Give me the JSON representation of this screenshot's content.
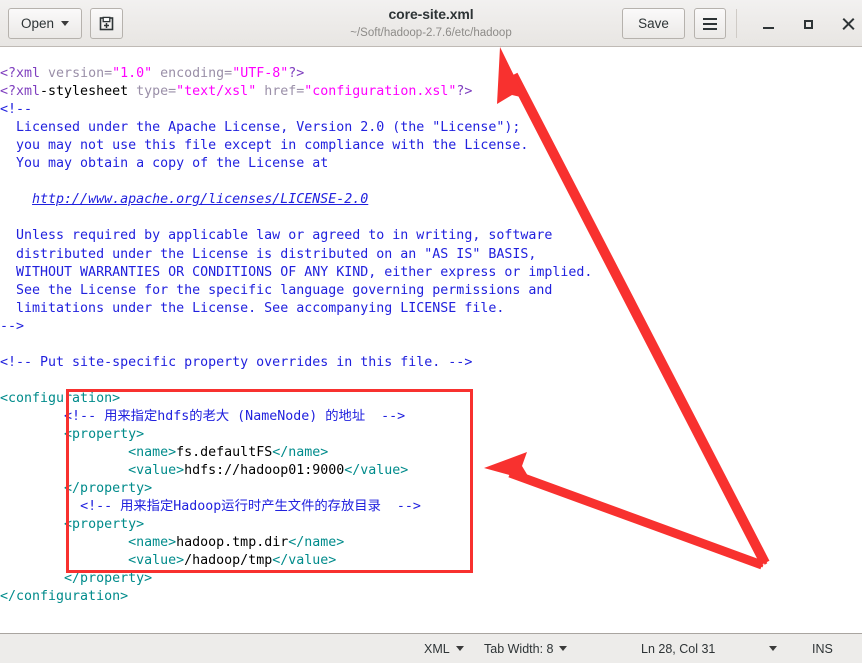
{
  "window": {
    "title": "core-site.xml",
    "subtitle": "~/Soft/hadoop-2.7.6/etc/hadoop"
  },
  "headerbar": {
    "open_label": "Open",
    "open_caret_icon": "chevron-down-icon",
    "new_tab_icon": "new-document-icon",
    "save_label": "Save",
    "menu_icon": "hamburger-menu-icon",
    "minimize_icon": "minimize-icon",
    "maximize_icon": "maximize-icon",
    "close_icon": "close-icon"
  },
  "statusbar": {
    "language": "XML",
    "language_caret_icon": "chevron-down-icon",
    "tab_width": "Tab Width: 8",
    "tab_width_caret_icon": "chevron-down-icon",
    "position": "Ln 28, Col 31",
    "position_caret_icon": "chevron-down-icon",
    "insert_mode": "INS"
  },
  "annotations": {
    "box_color": "#f8312f",
    "arrow_color": "#f8312f",
    "arrow_count": 2,
    "box_label": "highlighted-property-block"
  },
  "colors": {
    "comment": "#2121de",
    "tag": "#008b8b",
    "processing_instruction": "#7f3fbf",
    "string": "#ff00ff",
    "text": "#000000",
    "background": "#ffffff"
  },
  "document": {
    "filename": "core-site.xml",
    "language": "XML",
    "lines": [
      "<?xml version=\"1.0\" encoding=\"UTF-8\"?>",
      "<?xml-stylesheet type=\"text/xsl\" href=\"configuration.xsl\"?>",
      "<!--",
      "  Licensed under the Apache License, Version 2.0 (the \"License\");",
      "  you may not use this file except in compliance with the License.",
      "  You may obtain a copy of the License at",
      "",
      "    http://www.apache.org/licenses/LICENSE-2.0",
      "",
      "  Unless required by applicable law or agreed to in writing, software",
      "  distributed under the License is distributed on an \"AS IS\" BASIS,",
      "  WITHOUT WARRANTIES OR CONDITIONS OF ANY KIND, either express or implied.",
      "  See the License for the specific language governing permissions and",
      "  limitations under the License. See accompanying LICENSE file.",
      "-->",
      "",
      "<!-- Put site-specific property overrides in this file. -->",
      "",
      "<configuration>",
      "        <!-- 用来指定hdfs的老大 (NameNode) 的地址  -->",
      "        <property>",
      "                <name>fs.defaultFS</name>",
      "                <value>hdfs://hadoop01:9000</value>",
      "        </property>",
      "          <!-- 用来指定Hadoop运行时产生文件的存放目录  -->",
      "        <property>",
      "                <name>hadoop.tmp.dir</name>",
      "                <value>/hadoop/tmp</value>",
      "        </property>",
      "</configuration>"
    ],
    "link_text": "http://www.apache.org/licenses/LICENSE-2.0",
    "comment_cn_1": "用来指定hdfs的老大 (NameNode) 的地址",
    "comment_cn_2": "用来指定Hadoop运行时产生文件的存放目录",
    "property_1": {
      "name": "fs.defaultFS",
      "value": "hdfs://hadoop01:9000"
    },
    "property_2": {
      "name": "hadoop.tmp.dir",
      "value": "/hadoop/tmp"
    }
  }
}
